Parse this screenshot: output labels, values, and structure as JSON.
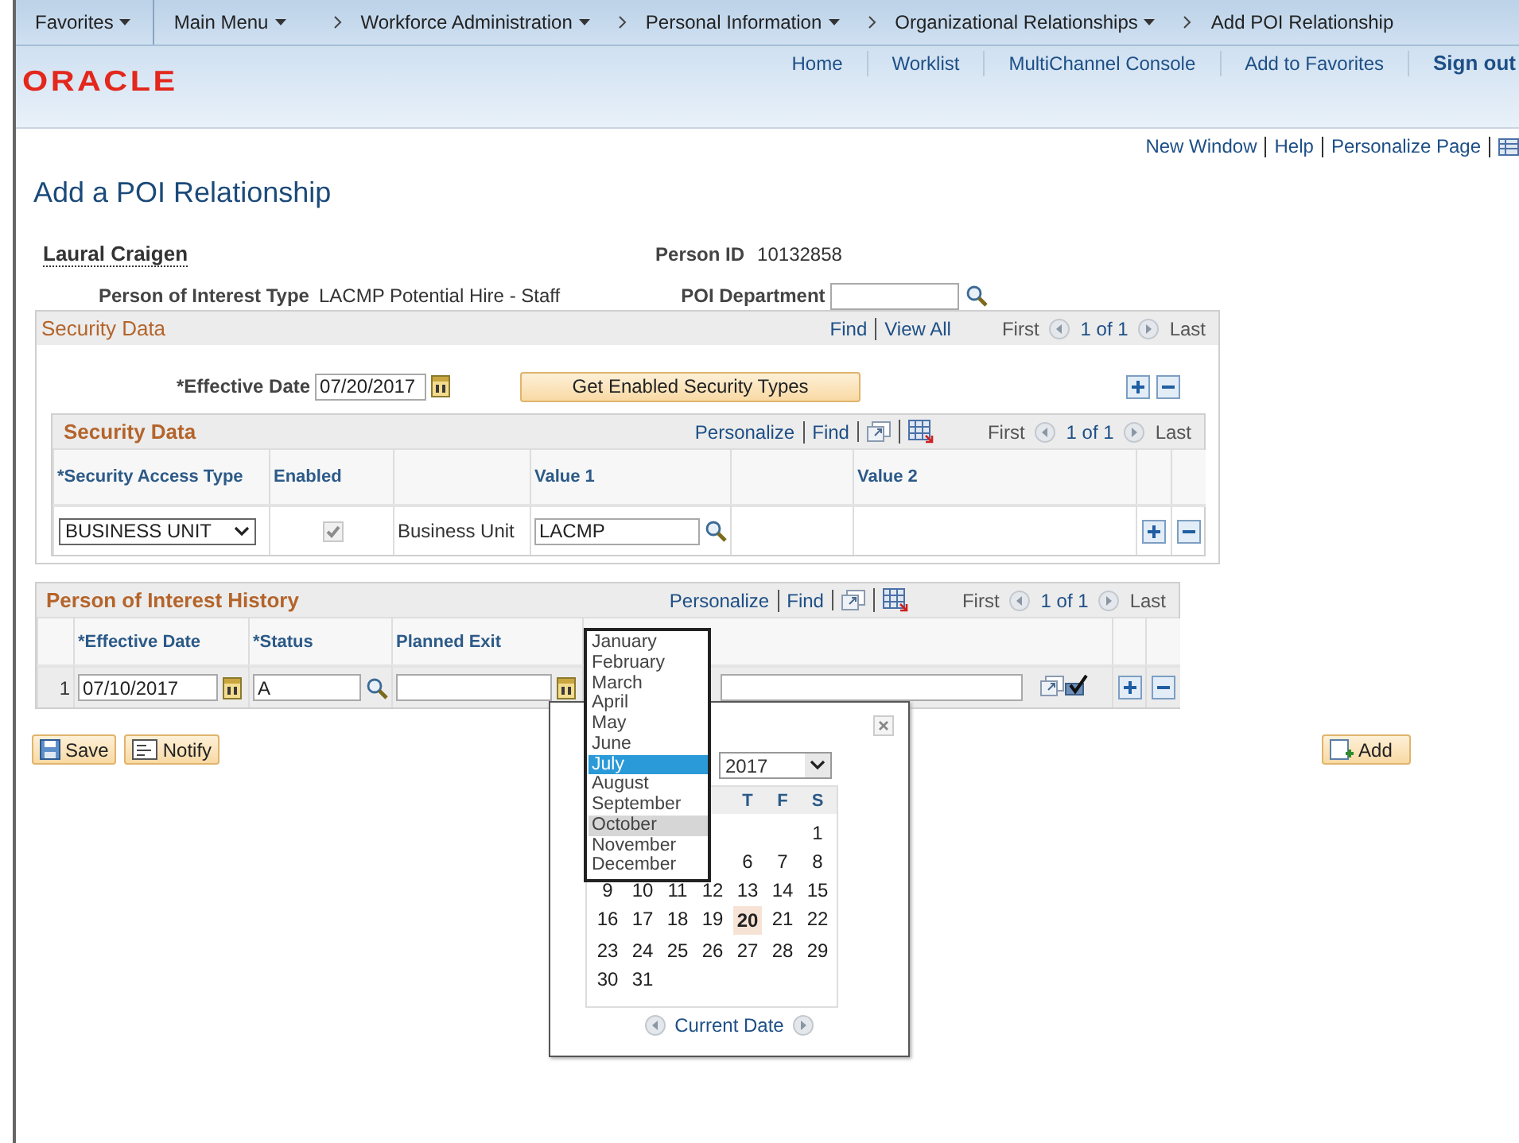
{
  "nav_bar": {
    "items": [
      {
        "label": "Favorites",
        "kind": "menu",
        "dropdown": true
      },
      {
        "label": "Main Menu",
        "kind": "menu",
        "dropdown": true
      },
      {
        "label": "Workforce Administration",
        "kind": "crumb",
        "dropdown": true
      },
      {
        "label": "Personal Information",
        "kind": "crumb",
        "dropdown": true
      },
      {
        "label": "Organizational Relationships",
        "kind": "crumb",
        "dropdown": true
      },
      {
        "label": "Add POI Relationship",
        "kind": "crumb",
        "dropdown": false
      }
    ]
  },
  "logo": "ORACLE",
  "header_links": [
    "Home",
    "Worklist",
    "MultiChannel Console",
    "Add to Favorites",
    "Sign out"
  ],
  "page_links": [
    "New Window",
    "Help",
    "Personalize Page"
  ],
  "page_title": "Add a POI Relationship",
  "person": {
    "name": "Laural Craigen",
    "id_label": "Person ID",
    "id": "10132858",
    "type_label": "Person of Interest Type",
    "type": "LACMP Potential Hire - Staff",
    "department_label": "POI Department"
  },
  "security_data": {
    "title": "Security Data",
    "links": [
      "Find",
      "View All"
    ],
    "nav": {
      "first": "First",
      "count": "1 of 1",
      "last": "Last"
    },
    "effective_date_label": "*Effective Date",
    "effective_date": "07/20/2017",
    "button": "Get Enabled Security Types",
    "grid": {
      "title": "Security Data",
      "links": [
        "Personalize",
        "Find"
      ],
      "nav": {
        "first": "First",
        "count": "1 of 1",
        "last": "Last"
      },
      "columns": [
        {
          "kind": "text",
          "label": "*Security Access Type"
        },
        {
          "kind": "text",
          "label": "Enabled"
        },
        {
          "kind": "blank"
        },
        {
          "kind": "text",
          "label": "Value 1"
        },
        {
          "kind": "blank"
        },
        {
          "kind": "text",
          "label": "Value 2"
        }
      ],
      "rows": [
        {
          "access_type": "BUSINESS UNIT",
          "checked": true,
          "disabled": true,
          "value_label": "Business Unit",
          "value_1": "LACMP"
        }
      ]
    }
  },
  "history": {
    "title": "Person of Interest History",
    "links": [
      "Personalize",
      "Find"
    ],
    "nav": {
      "first": "First",
      "count": "1 of 1",
      "last": "Last"
    },
    "columns": [
      "*Effective Date",
      "*Status",
      "Planned Exit"
    ],
    "rows": [
      {
        "row_number": "1",
        "effective_date": "07/10/2017",
        "status": "A"
      }
    ]
  },
  "buttons": {
    "save": "Save",
    "notify": "Notify",
    "add": "Add"
  },
  "calendar": {
    "year": "2017",
    "weekdays": {
      "kind": "end",
      "labels": [
        "T",
        "F",
        "S"
      ]
    },
    "weeks": [
      {
        "kind": "end",
        "days": [
          {
            "day": "1",
            "selected": false
          }
        ]
      },
      {
        "kind": "end",
        "days": [
          {
            "day": "6",
            "selected": false
          },
          {
            "day": "7",
            "selected": false
          },
          {
            "day": "8",
            "selected": false
          }
        ]
      },
      {
        "kind": "start",
        "days": [
          {
            "day": "9",
            "selected": false
          },
          {
            "day": "10",
            "selected": false
          },
          {
            "day": "11",
            "selected": false
          },
          {
            "day": "12",
            "selected": false
          },
          {
            "day": "13",
            "selected": false
          },
          {
            "day": "14",
            "selected": false
          },
          {
            "day": "15",
            "selected": false
          }
        ]
      },
      {
        "kind": "start",
        "days": [
          {
            "day": "16",
            "selected": false
          },
          {
            "day": "17",
            "selected": false
          },
          {
            "day": "18",
            "selected": false
          },
          {
            "day": "19",
            "selected": false
          },
          {
            "day": "20",
            "selected": true
          },
          {
            "day": "21",
            "selected": false
          },
          {
            "day": "22",
            "selected": false
          }
        ]
      },
      {
        "kind": "start",
        "days": [
          {
            "day": "23",
            "selected": false
          },
          {
            "day": "24",
            "selected": false
          },
          {
            "day": "25",
            "selected": false
          },
          {
            "day": "26",
            "selected": false
          },
          {
            "day": "27",
            "selected": false
          },
          {
            "day": "28",
            "selected": false
          },
          {
            "day": "29",
            "selected": false
          }
        ]
      },
      {
        "kind": "start",
        "days": [
          {
            "day": "30",
            "selected": false
          },
          {
            "day": "31",
            "selected": false
          }
        ]
      }
    ],
    "current_date": "Current Date"
  },
  "month_list": {
    "months": [
      {
        "label": "January",
        "selected": false,
        "hovered": false
      },
      {
        "label": "February",
        "selected": false,
        "hovered": false
      },
      {
        "label": "March",
        "selected": false,
        "hovered": false
      },
      {
        "label": "April",
        "selected": false,
        "hovered": false
      },
      {
        "label": "May",
        "selected": false,
        "hovered": false
      },
      {
        "label": "June",
        "selected": false,
        "hovered": false
      },
      {
        "label": "July",
        "selected": true,
        "hovered": false
      },
      {
        "label": "August",
        "selected": false,
        "hovered": false
      },
      {
        "label": "September",
        "selected": false,
        "hovered": false
      },
      {
        "label": "October",
        "selected": false,
        "hovered": true
      },
      {
        "label": "November",
        "selected": false,
        "hovered": false
      },
      {
        "label": "December",
        "selected": false,
        "hovered": false
      }
    ]
  }
}
